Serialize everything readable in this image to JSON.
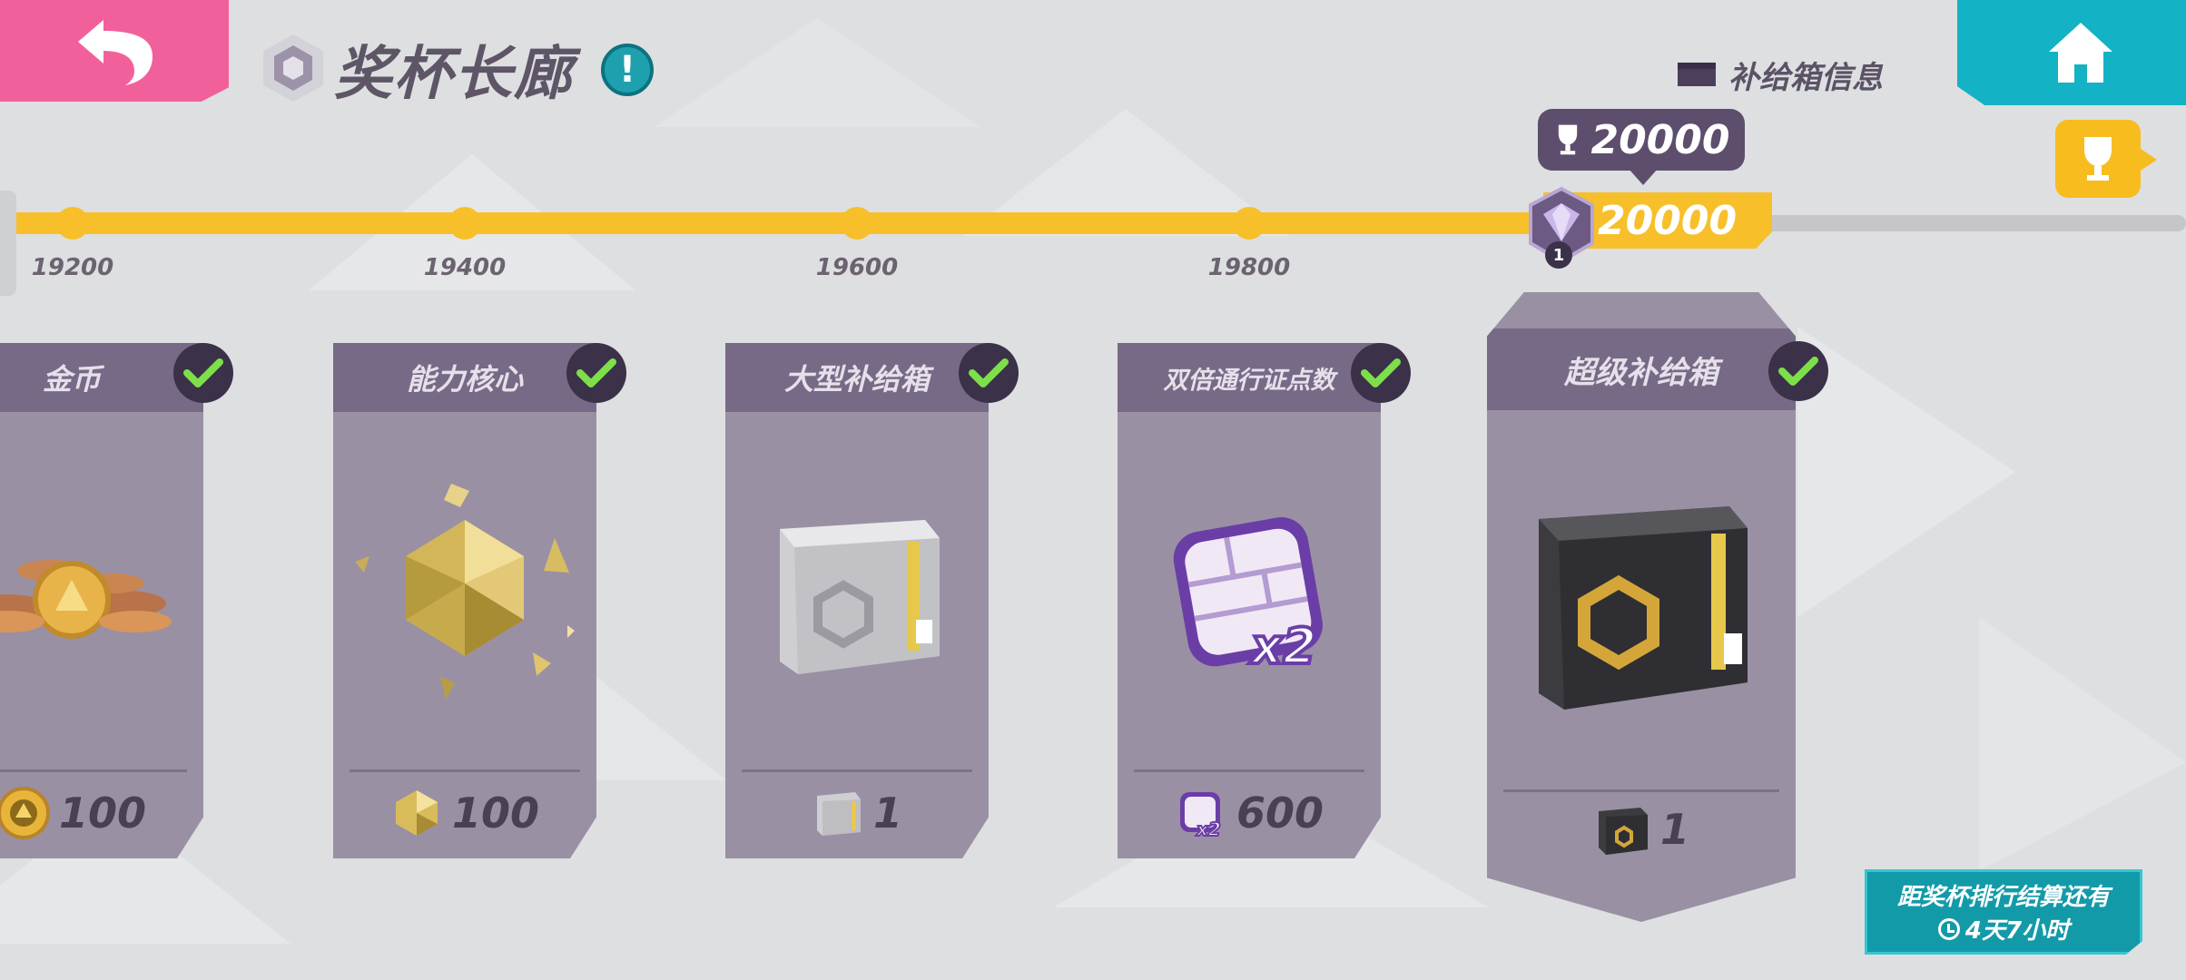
{
  "header": {
    "title": "奖杯长廊",
    "info_badge": "!",
    "supply_info_label": "补给箱信息"
  },
  "icons": {
    "back": "back-arrow-icon",
    "home": "home-icon",
    "trophy": "trophy-icon",
    "supply_box": "supply-box-icon"
  },
  "colors": {
    "back_button": "#f2609c",
    "home_button": "#13b2c4",
    "progress": "#f7c02a",
    "card": "#9a90a4",
    "card_header": "#776a86"
  },
  "progress": {
    "milestones": [
      "19200",
      "19400",
      "19600",
      "19800"
    ],
    "current_value": "20000",
    "callout_value": "20000",
    "rank_level": "1"
  },
  "rewards": [
    {
      "name": "金币",
      "amount": "100",
      "claimed": true
    },
    {
      "name": "能力核心",
      "amount": "100",
      "claimed": true
    },
    {
      "name": "大型补给箱",
      "amount": "1",
      "claimed": true
    },
    {
      "name": "双倍通行证点数",
      "amount": "600",
      "claimed": true
    },
    {
      "name": "超级补给箱",
      "amount": "1",
      "claimed": true
    }
  ],
  "countdown": {
    "label": "距奖杯排行结算还有",
    "time": "4天7小时"
  }
}
